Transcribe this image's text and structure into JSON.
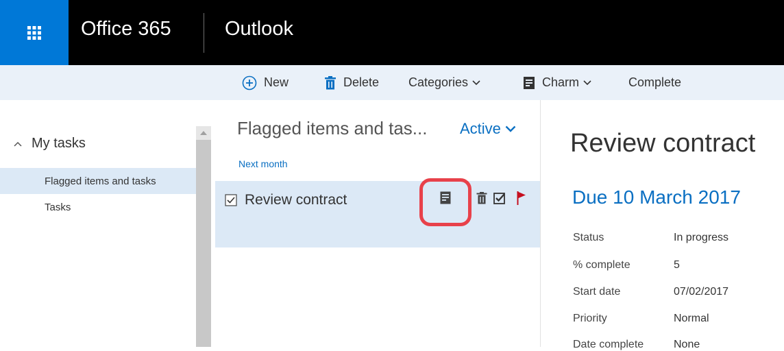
{
  "header": {
    "brand": "Office 365",
    "app": "Outlook",
    "colors": {
      "bar": "#000000",
      "waffle": "#0078d7"
    }
  },
  "toolbar": {
    "new_label": "New",
    "delete_label": "Delete",
    "categories_label": "Categories",
    "charm_label": "Charm",
    "complete_label": "Complete"
  },
  "sidebar": {
    "section_label": "My tasks",
    "items": [
      {
        "label": "Flagged items and tasks",
        "selected": true
      },
      {
        "label": "Tasks",
        "selected": false
      }
    ]
  },
  "list": {
    "title": "Flagged items and tas...",
    "filter_label": "Active",
    "group_header": "Next month",
    "task": {
      "title": "Review contract",
      "icons": [
        "charm-icon",
        "delete-icon",
        "complete-icon",
        "flag-icon"
      ]
    }
  },
  "detail": {
    "title": "Review contract",
    "due": "Due 10 March 2017",
    "properties": [
      {
        "label": "Status",
        "value": "In progress"
      },
      {
        "label": "% complete",
        "value": "5"
      },
      {
        "label": "Start date",
        "value": "07/02/2017"
      },
      {
        "label": "Priority",
        "value": "Normal"
      },
      {
        "label": "Date complete",
        "value": "None"
      }
    ]
  },
  "colors": {
    "accent": "#0a6fc2",
    "selection": "#dce9f6",
    "highlight_ring": "#e8414a",
    "flag": "#c50f1f"
  }
}
